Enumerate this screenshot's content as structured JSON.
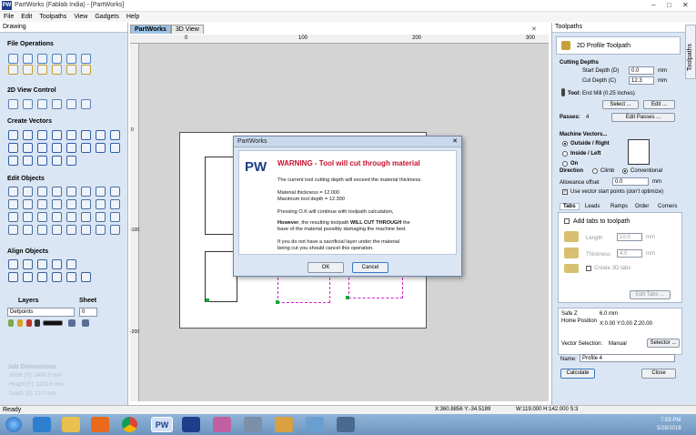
{
  "app": {
    "title": "PartWorks (Fablab India) - [PartWorks]",
    "logo_text": "PW"
  },
  "menu": [
    "File",
    "Edit",
    "Toolpaths",
    "View",
    "Gadgets",
    "Help"
  ],
  "left_panel": {
    "title": "Drawing",
    "sections": {
      "file_operations": "File Operations",
      "view_control": "2D View Control",
      "create_vectors": "Create Vectors",
      "edit_objects": "Edit Objects",
      "align_objects": "Align Objects"
    },
    "layers_label": "Layers",
    "sheet_label": "Sheet",
    "layer_value": "Defpoints",
    "sheet_value": "0",
    "job_dimensions": {
      "title": "Job Dimensions",
      "width": "Width  [X]: 2400.0 mm",
      "height": "Height [Y]: 1200.0 mm",
      "depth": "Depth  [Z]: 12.0 mm"
    }
  },
  "doc_tabs": [
    "PartWorks",
    "3D View"
  ],
  "ruler": {
    "top": [
      "0",
      "100",
      "200",
      "300"
    ],
    "left": [
      "0",
      "-100",
      "-200"
    ]
  },
  "dialog": {
    "title": "PartWorks",
    "logo": "PW",
    "heading": "WARNING - Tool will cut through material",
    "line1": "The current tool cutting depth will exceed the material thickness.",
    "line2": "Material thickness = 12.000",
    "line3": "Maximum tool depth = 12.300",
    "line4": "Pressing O.K will continue with toolpath calculation,",
    "line5a": "However",
    "line5b": ", the resulting toolpath ",
    "line5c": "WILL CUT THROUGH",
    "line5d": " the",
    "line6": "base of the material possibly damaging the machine bed.",
    "line7": "If you do not have a sacrificial layer under the material",
    "line8": "being cut you should cancel this operation.",
    "ok": "OK",
    "cancel": "Cancel"
  },
  "right_panel": {
    "title": "Toolpaths",
    "side_tab": "Toolpaths",
    "toolpath_name": "2D Profile Toolpath",
    "cutting_depths": "Cutting Depths",
    "start_depth_label": "Start Depth (D)",
    "start_depth": "0.0",
    "cut_depth_label": "Cut Depth (C)",
    "cut_depth": "12.3",
    "unit": "mm",
    "tool_label": "Tool:",
    "tool_value": "End Mill (0.25 inches)",
    "select_btn": "Select ...",
    "edit_btn": "Edit ...",
    "passes_label": "Passes:",
    "passes_value": "4",
    "edit_passes_btn": "Edit Passes ...",
    "machine_vectors": "Machine Vectors...",
    "outside": "Outside / Right",
    "inside": "Inside / Left",
    "on": "On",
    "direction_label": "Direction",
    "climb": "Climb",
    "conventional": "Conventional",
    "allowance_label": "Allowance offset",
    "allowance": "0.0",
    "use_vector_start": "Use vector start points (don't optimize)",
    "tabs": [
      "Tabs",
      "Leads",
      "Ramps",
      "Order",
      "Corners"
    ],
    "add_tabs": "Add tabs to toolpath",
    "length_label": "Length",
    "length": "10.0",
    "thickness_label": "Thickness",
    "thickness": "4.0",
    "create_3d_tabs": "Create 3D tabs",
    "edit_tabs_btn": "Edit Tabs ...",
    "safe_z_label": "Safe Z",
    "safe_z": "6.0 mm",
    "home_label": "Home Position",
    "home": "X:0.00 Y:0.00 Z:20.00",
    "vector_selection_label": "Vector Selection:",
    "vector_selection": "Manual",
    "selector_btn": "Selector ...",
    "name_label": "Name:",
    "name": "Profile 4",
    "calculate": "Calculate",
    "close": "Close"
  },
  "status": {
    "left": "Ready",
    "coords": "X:360.8856 Y:-34.5189",
    "size": "W:119.000   H:142.000  S:3"
  },
  "taskbar": {
    "time": "7:53 PM",
    "date": "5/28/2018"
  },
  "colors": {
    "accent": "#1f3e8a",
    "warning_red": "#c8102e",
    "panel": "#dbe6f4",
    "toolpath": "#d21fd2"
  }
}
